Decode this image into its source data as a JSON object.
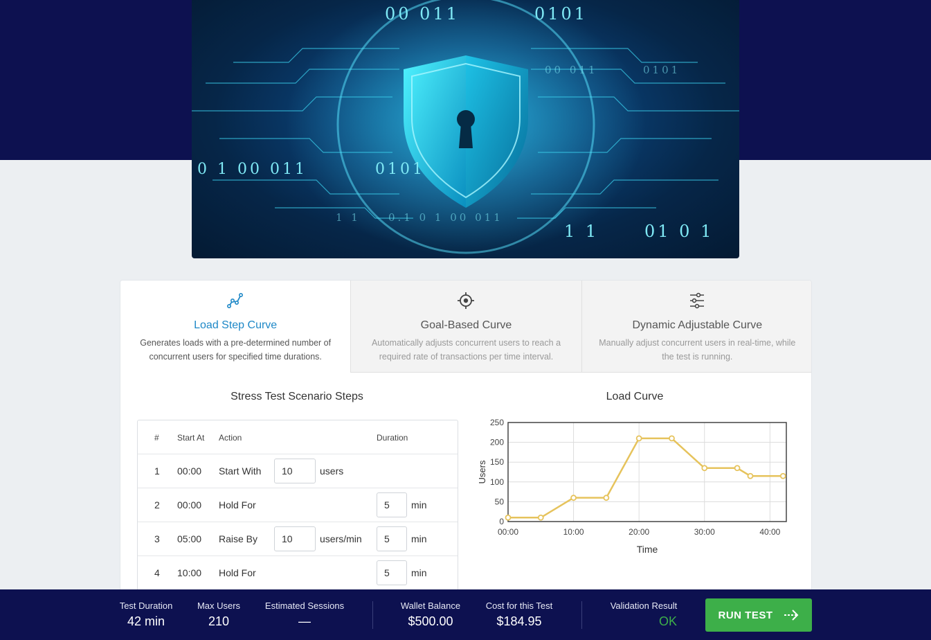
{
  "hero": {
    "bits": [
      "00  011",
      "0101",
      "0  1  00  011",
      "0101",
      "1 1",
      "01  0  1",
      "0.1  0  1  00  011",
      "1 1",
      "00  011",
      "0101"
    ]
  },
  "tabs": [
    {
      "title": "Load Step Curve",
      "desc": "Generates loads with a pre-determined number of concurrent users for specified time durations.",
      "icon": "line-graph-icon",
      "active": true
    },
    {
      "title": "Goal-Based Curve",
      "desc": "Automatically adjusts concurrent users to reach a required rate of transactions per time interval.",
      "icon": "target-icon",
      "active": false
    },
    {
      "title": "Dynamic Adjustable Curve",
      "desc": "Manually adjust concurrent users in real-time, while the test is running.",
      "icon": "sliders-icon",
      "active": false
    }
  ],
  "steps": {
    "title": "Stress Test Scenario Steps",
    "headers": {
      "num": "#",
      "start": "Start At",
      "action": "Action",
      "duration": "Duration"
    },
    "rows": [
      {
        "num": "1",
        "start": "00:00",
        "action": "Start With",
        "value": "10",
        "unit": "users",
        "duration": "",
        "dur_unit": ""
      },
      {
        "num": "2",
        "start": "00:00",
        "action": "Hold For",
        "value": "",
        "unit": "",
        "duration": "5",
        "dur_unit": "min"
      },
      {
        "num": "3",
        "start": "05:00",
        "action": "Raise By",
        "value": "10",
        "unit": "users/min",
        "duration": "5",
        "dur_unit": "min"
      },
      {
        "num": "4",
        "start": "10:00",
        "action": "Hold For",
        "value": "",
        "unit": "",
        "duration": "5",
        "dur_unit": "min"
      }
    ]
  },
  "chart_data": {
    "type": "line",
    "title": "Load Curve",
    "xlabel": "Time",
    "ylabel": "Users",
    "x": [
      0,
      5,
      10,
      15,
      20,
      25,
      30,
      35,
      37,
      42
    ],
    "series": [
      {
        "values": [
          10,
          10,
          60,
          60,
          210,
          210,
          135,
          135,
          115,
          115
        ]
      }
    ],
    "xticks": [
      0,
      10,
      20,
      30,
      40
    ],
    "xtick_labels": [
      "00:00",
      "10:00",
      "20:00",
      "30:00",
      "40:00"
    ],
    "yticks": [
      0,
      50,
      100,
      150,
      200,
      250
    ],
    "xlim": [
      0,
      42.5
    ],
    "ylim": [
      0,
      250
    ],
    "grid": true,
    "color": "#e6c35c"
  },
  "footer": {
    "test_duration_label": "Test Duration",
    "test_duration": "42 min",
    "max_users_label": "Max Users",
    "max_users": "210",
    "est_sessions_label": "Estimated Sessions",
    "est_sessions": "—",
    "wallet_label": "Wallet Balance",
    "wallet": "$500.00",
    "cost_label": "Cost for this Test",
    "cost": "$184.95",
    "validation_label": "Validation Result",
    "validation": "OK",
    "run_label": "RUN TEST"
  },
  "colors": {
    "accent": "#1e88c7",
    "navy": "#0d1150",
    "run": "#3daf49",
    "ok": "#3daf49"
  }
}
